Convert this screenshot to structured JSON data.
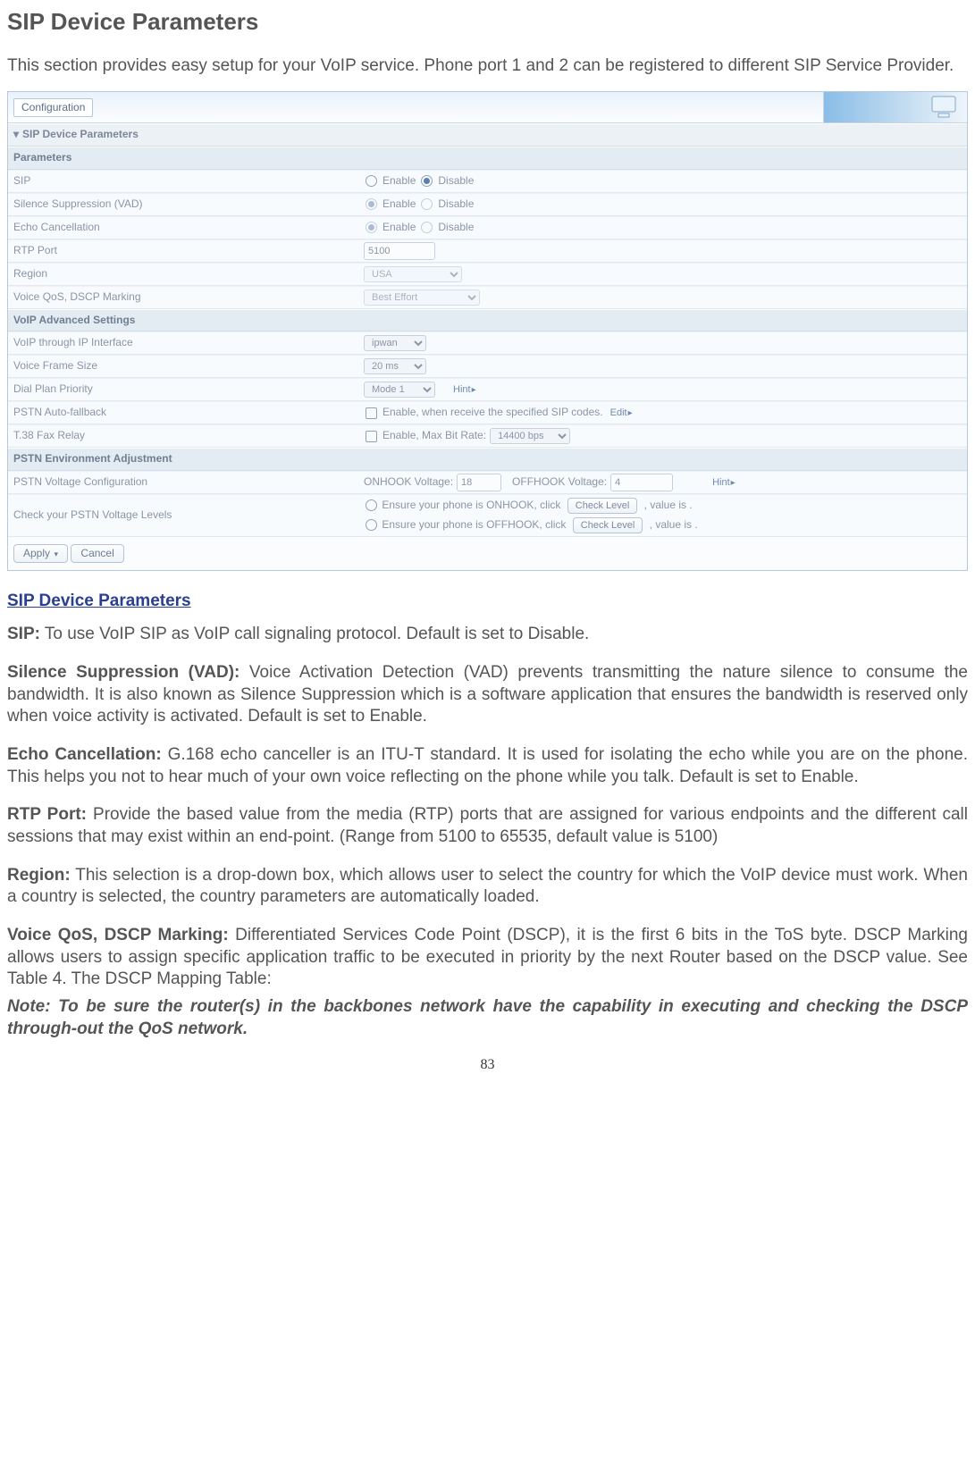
{
  "page": {
    "title": "SIP Device Parameters",
    "intro": "This section provides easy setup for your VoIP service. Phone port 1 and 2 can be registered to different SIP Service Provider.",
    "number": "83"
  },
  "screenshot": {
    "header_tab": "Configuration",
    "accordion": "SIP Device Parameters",
    "section_params": "Parameters",
    "rows": {
      "sip": {
        "label": "SIP",
        "opt_enable": "Enable",
        "opt_disable": "Disable"
      },
      "vad": {
        "label": "Silence Suppression (VAD)",
        "opt_enable": "Enable",
        "opt_disable": "Disable"
      },
      "echo": {
        "label": "Echo Cancellation",
        "opt_enable": "Enable",
        "opt_disable": "Disable"
      },
      "rtp": {
        "label": "RTP Port",
        "value": "5100"
      },
      "region": {
        "label": "Region",
        "value": "USA"
      },
      "qos": {
        "label": "Voice QoS, DSCP Marking",
        "value": "Best Effort"
      }
    },
    "section_adv": "VoIP Advanced Settings",
    "adv": {
      "iface": {
        "label": "VoIP through IP Interface",
        "value": "ipwan"
      },
      "frame": {
        "label": "Voice Frame Size",
        "value": "20 ms"
      },
      "dial": {
        "label": "Dial Plan Priority",
        "value": "Mode 1",
        "hint": "Hint"
      },
      "fallback": {
        "label": "PSTN Auto-fallback",
        "text": "Enable, when receive the specified SIP codes.",
        "edit": "Edit"
      },
      "t38": {
        "label": "T.38 Fax Relay",
        "text": "Enable, Max Bit Rate:",
        "value": "14400 bps"
      }
    },
    "section_pstn": "PSTN Environment Adjustment",
    "pstn": {
      "volt": {
        "label": "PSTN Voltage Configuration",
        "onhook_label": "ONHOOK Voltage:",
        "onhook_val": "18",
        "offhook_label": "OFFHOOK Voltage:",
        "offhook_val": "4",
        "hint": "Hint"
      },
      "check": {
        "label": "Check your PSTN Voltage Levels",
        "line1_a": "Ensure your phone is ONHOOK, click",
        "btn": "Check Level",
        "line1_b": ", value is  .",
        "line2_a": "Ensure your phone is OFFHOOK, click",
        "line2_b": ", value is  ."
      }
    },
    "buttons": {
      "apply": "Apply",
      "cancel": "Cancel"
    }
  },
  "doc": {
    "sub": "SIP Device Parameters",
    "sip_b": "SIP:",
    "sip_t": " To use VoIP SIP as VoIP call signaling protocol. Default is set to Disable.",
    "vad_b": "Silence Suppression (VAD):",
    "vad_t": " Voice Activation Detection (VAD) prevents transmitting the nature silence to consume the bandwidth. It is also known as Silence Suppression which is a software application that ensures the bandwidth is reserved only when voice activity is activated.  Default is set to Enable.",
    "echo_b": "Echo Cancellation:",
    "echo_t": " G.168 echo canceller is an ITU-T standard.  It is used for isolating the echo while you are on the phone. This helps you not to hear much of your own voice reflecting on the phone while you talk. Default is set to Enable.",
    "rtp_b": "RTP Port:",
    "rtp_t": " Provide the based value from the media (RTP) ports that are assigned for various endpoints and the different call sessions that may exist within an end-point. (Range from 5100 to 65535, default value is 5100)",
    "region_b": "Region:",
    "region_t": " This selection is a drop-down box, which allows user to select the country for which the VoIP device must work. When a country is selected, the country parameters are automatically loaded.",
    "qos_b": "Voice QoS, DSCP Marking:",
    "qos_t": " Differentiated Services Code Point (DSCP), it is the first 6 bits in the ToS byte. DSCP Marking allows users to assign specific application traffic to be executed in priority by the next Router based on the DSCP value.  See Table 4. The DSCP Mapping Table:",
    "note": "Note: To be sure the router(s) in the backbones network have the capability in executing and checking the DSCP through-out the QoS network."
  }
}
